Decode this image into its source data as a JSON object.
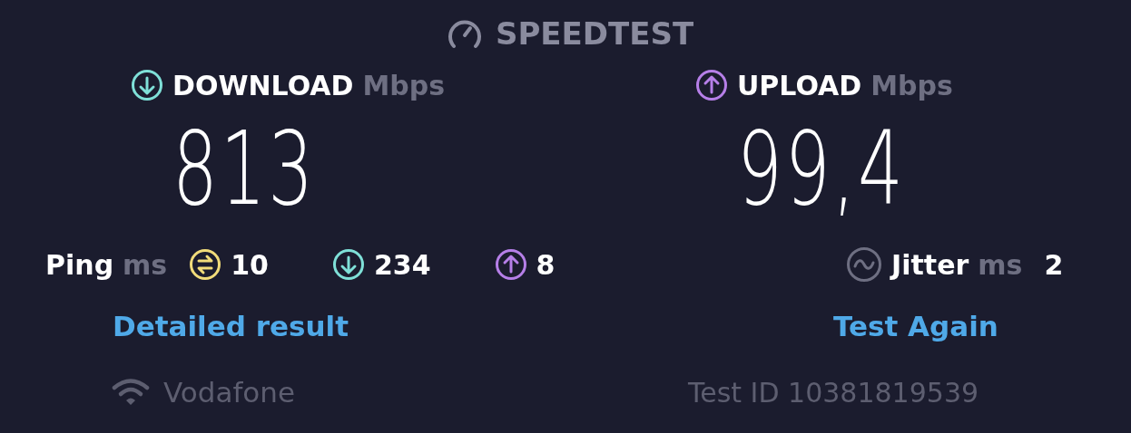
{
  "header": {
    "title": "SPEEDTEST"
  },
  "results": [
    {
      "kind": "download",
      "label": "DOWNLOAD",
      "unit": "Mbps",
      "value": "813",
      "color": "#7fe0d8"
    },
    {
      "kind": "upload",
      "label": "UPLOAD",
      "unit": "Mbps",
      "value": "99,4",
      "color": "#b67fe8"
    }
  ],
  "ping": {
    "label": "Ping",
    "unit": "ms",
    "values": [
      {
        "kind": "idle",
        "value": "10",
        "color": "#f2dc7a"
      },
      {
        "kind": "download",
        "value": "234",
        "color": "#7fe0d8"
      },
      {
        "kind": "upload",
        "value": "8",
        "color": "#b67fe8"
      }
    ]
  },
  "jitter": {
    "label": "Jitter",
    "unit": "ms",
    "value": "2"
  },
  "links": [
    "Detailed result",
    "Test Again"
  ],
  "provider": "Vodafone",
  "test_id": "Test ID 10381819539"
}
